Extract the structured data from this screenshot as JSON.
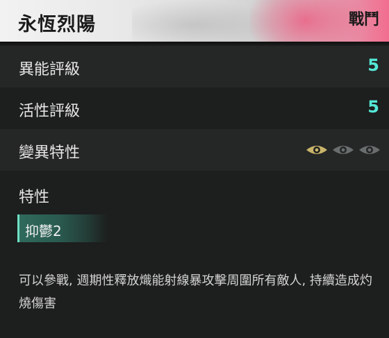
{
  "header": {
    "title": "永恆烈陽",
    "tag": "戰鬥"
  },
  "stats": [
    {
      "label": "異能評級",
      "value": "5"
    },
    {
      "label": "活性評級",
      "value": "5"
    },
    {
      "label": "變異特性",
      "eyes_total": 3,
      "eyes_active": 1
    }
  ],
  "traits": {
    "title": "特性",
    "items": [
      "抑鬱2"
    ]
  },
  "description": "可以參戰, 週期性釋放熾能射線暴攻擊周圍所有敵人, 持續造成灼燒傷害",
  "colors": {
    "value": "#54e8d6",
    "eye_active": "#c8b46a",
    "eye_inactive": "#6a6d6d",
    "chip_accent": "#6fe0c4"
  }
}
